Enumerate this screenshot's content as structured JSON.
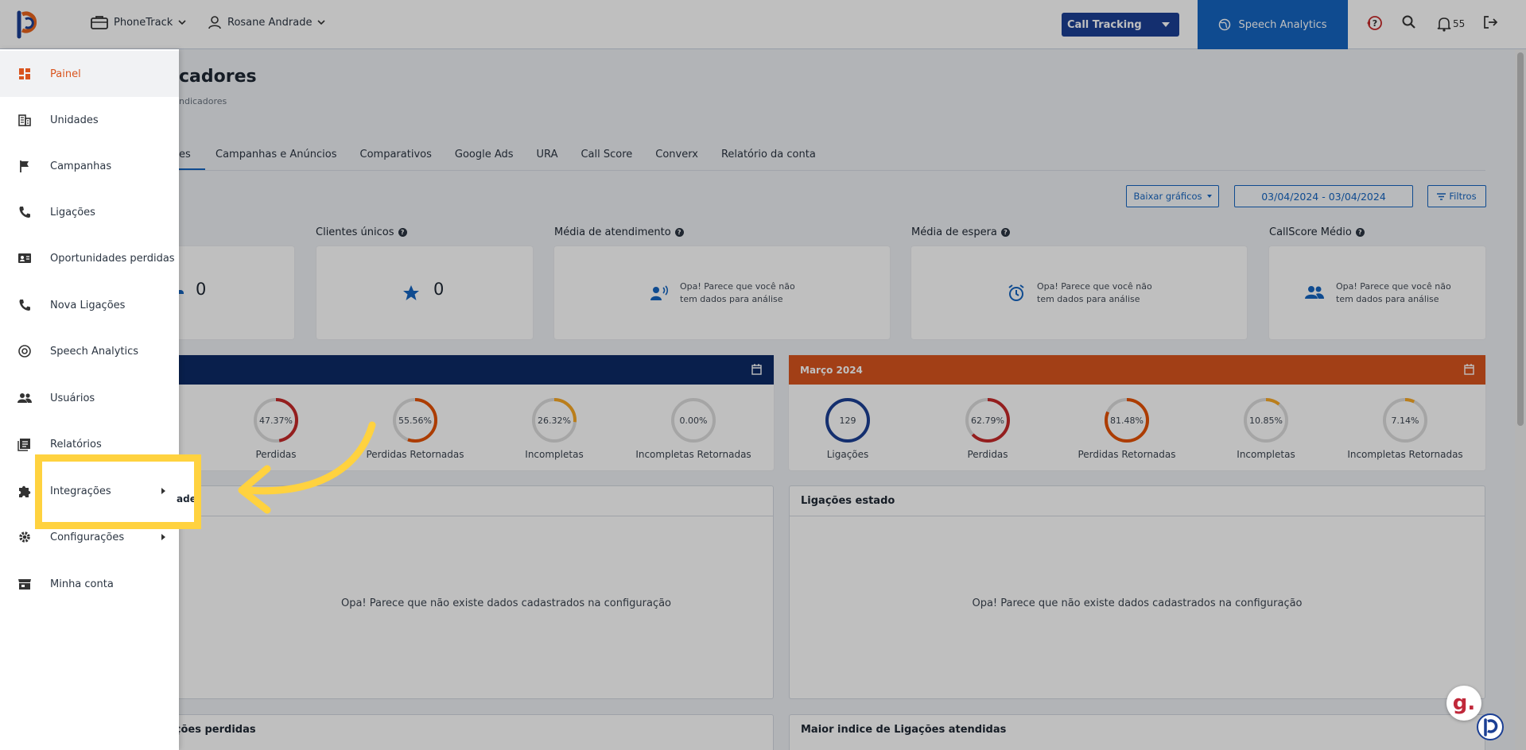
{
  "topbar": {
    "company": "PhoneTrack",
    "user": "Rosane Andrade",
    "product_select": "Call Tracking",
    "speech_button": "Speech Analytics",
    "notification_count": "55"
  },
  "page": {
    "title": "cadores",
    "breadcrumb": "ndicadores"
  },
  "tabs": [
    {
      "label": "es"
    },
    {
      "label": "Campanhas e Anúncios"
    },
    {
      "label": "Comparativos"
    },
    {
      "label": "Google Ads"
    },
    {
      "label": "URA"
    },
    {
      "label": "Call Score"
    },
    {
      "label": "Converx"
    },
    {
      "label": "Relatório da conta"
    }
  ],
  "toolbar": {
    "download_label": "Baixar gráficos",
    "date_range": "03/04/2024 - 03/04/2024",
    "filters_label": "Filtros"
  },
  "kpis": {
    "first_value": "0",
    "unique_clients": {
      "label": "Clientes únicos",
      "value": "0"
    },
    "avg_service": {
      "label": "Média de atendimento",
      "msg1": "Opa! Parece que você não",
      "msg2": "tem dados para análise"
    },
    "avg_wait": {
      "label": "Média de espera",
      "msg1": "Opa! Parece que você não",
      "msg2": "tem dados para análise"
    },
    "callscore": {
      "label": "CallScore Médio",
      "msg1": "Opa! Parece que você não",
      "msg2": "tem dados para análise"
    }
  },
  "left_panel": {
    "color": "#0d2a66",
    "gauges": [
      {
        "pct": "47.37%",
        "label": "Perdidas",
        "fraction": 0.4737,
        "color": "#c62828"
      },
      {
        "pct": "55.56%",
        "label": "Perdidas Retornadas",
        "fraction": 0.5556,
        "color": "#e65100"
      },
      {
        "pct": "26.32%",
        "label": "Incompletas",
        "fraction": 0.2632,
        "color": "#f9a825"
      },
      {
        "pct": "0.00%",
        "label": "Incompletas Retornadas",
        "fraction": 0.0,
        "color": "#f9a825"
      }
    ]
  },
  "right_panel": {
    "title": "Março 2024",
    "color": "#d9541e",
    "gauges": [
      {
        "pct": "129",
        "label": "Ligações",
        "fraction": 1.0,
        "color": "#1b3f94"
      },
      {
        "pct": "62.79%",
        "label": "Perdidas",
        "fraction": 0.6279,
        "color": "#c62828"
      },
      {
        "pct": "81.48%",
        "label": "Perdidas Retornadas",
        "fraction": 0.8148,
        "color": "#e65100"
      },
      {
        "pct": "10.85%",
        "label": "Incompletas",
        "fraction": 0.1085,
        "color": "#f9a825"
      },
      {
        "pct": "7.14%",
        "label": "Incompletas Retornadas",
        "fraction": 0.0714,
        "color": "#f9a825"
      }
    ]
  },
  "panels": {
    "left_partial_title": "ade",
    "right_title": "Ligações estado",
    "empty_msg": "Opa! Parece que não existe dados cadastrados na configuração",
    "bottom_left_title": "ações perdidas",
    "bottom_right_title": "Maior indice de Ligações atendidas"
  },
  "sidebar": {
    "items": [
      {
        "label": "Painel",
        "icon": "dashboard-icon"
      },
      {
        "label": "Unidades",
        "icon": "building-icon"
      },
      {
        "label": "Campanhas",
        "icon": "flag-icon"
      },
      {
        "label": "Ligações",
        "icon": "phone-icon"
      },
      {
        "label": "Oportunidades perdidas",
        "icon": "contact-card-icon"
      },
      {
        "label": "Nova Ligações",
        "icon": "phone-icon"
      },
      {
        "label": "Speech Analytics",
        "icon": "speech-icon"
      },
      {
        "label": "Usuários",
        "icon": "users-icon"
      },
      {
        "label": "Relatórios",
        "icon": "report-icon"
      },
      {
        "label": "Integrações",
        "icon": "puzzle-icon"
      },
      {
        "label": "Configurações",
        "icon": "gear-icon"
      },
      {
        "label": "Minha conta",
        "icon": "store-icon"
      }
    ]
  },
  "chat": {
    "letter": "g."
  }
}
